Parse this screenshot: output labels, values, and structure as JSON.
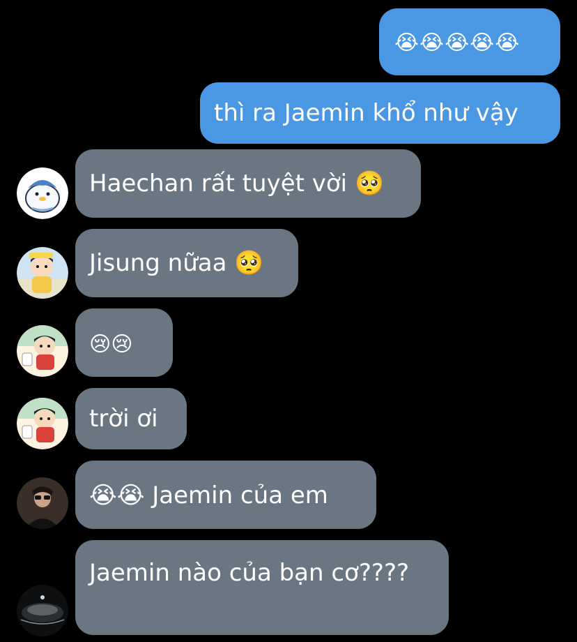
{
  "messages": [
    {
      "direction": "outgoing",
      "text": "😭😭😭😭😭"
    },
    {
      "direction": "outgoing",
      "text": "thì ra Jaemin khổ như vậy"
    },
    {
      "direction": "incoming",
      "text": "Haechan rất tuyệt vời 🥺",
      "avatar": "penguin-avatar"
    },
    {
      "direction": "incoming",
      "text": "Jisung nữaa 🥺",
      "avatar": "cartoon-boy-avatar"
    },
    {
      "direction": "incoming",
      "text": "😢😢",
      "avatar": "cartoon-boy-avatar"
    },
    {
      "direction": "incoming",
      "text": "trời ơi",
      "avatar": "cartoon-boy-avatar"
    },
    {
      "direction": "incoming",
      "text": "😭😭 Jaemin của em",
      "avatar": "person-photo-avatar"
    },
    {
      "direction": "incoming",
      "text": "Jaemin nào của bạn cơ????",
      "avatar": "dark-photo-avatar"
    }
  ],
  "colors": {
    "background": "#000000",
    "outgoing_bubble": "#4a97e4",
    "incoming_bubble": "#6b7683",
    "text": "#ffffff"
  }
}
